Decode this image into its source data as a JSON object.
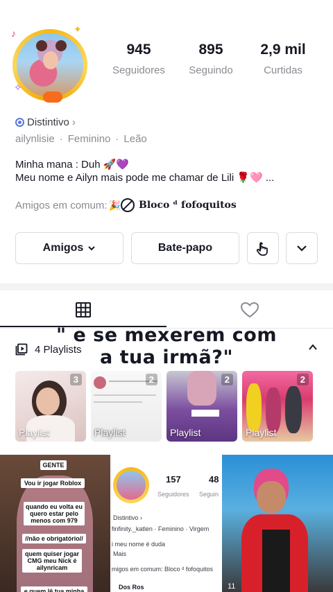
{
  "profile": {
    "stats": [
      {
        "value": "945",
        "label": "Seguidores"
      },
      {
        "value": "895",
        "label": "Seguindo"
      },
      {
        "value": "2,9 mil",
        "label": "Curtidas"
      }
    ],
    "badge_label": "Distintivo",
    "meta": [
      "ailynlisie",
      "Feminino",
      "Leão"
    ],
    "bio_line1": "Minha mana : Duh 🚀💜",
    "bio_line2": "Meu nome e Ailyn mais pode me chamar de Lili 🌹🩷 ...",
    "friends_prefix": "Amigos em comum:",
    "friends_names": "Bloco ᵈ fofoquitos"
  },
  "actions": {
    "friends_label": "Amigos",
    "chat_label": "Bate-papo"
  },
  "overlay_caption": {
    "line1": "\" e se mexerem com",
    "line2": "a tua irmã?\""
  },
  "playlists": {
    "header": "4 Playlists",
    "items": [
      {
        "label": "Playlist",
        "count": "3"
      },
      {
        "label": "Playlist",
        "count": "2"
      },
      {
        "label": "Playlist",
        "count": "2"
      },
      {
        "label": "Playlist",
        "count": "2"
      }
    ]
  },
  "videos": [
    {
      "notes": [
        "GENTE",
        "Vou ir jogar Roblox",
        "quando eu volta eu quero estar pelo menos com 979",
        "//não e obrigatório//",
        "quem quiser jogar CMG meu Nick é ailynricam",
        "e quem lê tua minha"
      ]
    },
    {
      "stats": [
        "157",
        "48"
      ],
      "stat_label": "Seguidores",
      "stat_label2": "Seguin",
      "lines": [
        "Distintivo ›",
        "finfinity._katlen · Feminino · Virgem",
        "i meu nome é duda",
        "Mais",
        "migos em comum: Bloco ᵈ fofoquitos",
        "Dos Ros"
      ]
    },
    {
      "views": "11"
    }
  ]
}
